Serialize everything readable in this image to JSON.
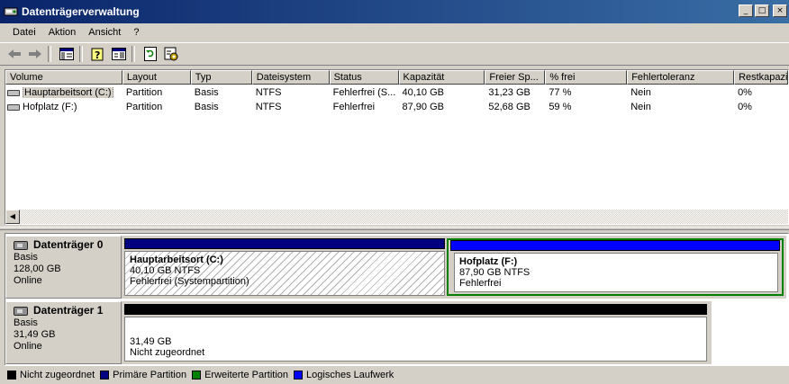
{
  "window": {
    "title": "Datenträgerverwaltung",
    "controls": {
      "minimize": "_",
      "maximize": "□",
      "close": "×"
    }
  },
  "menu": [
    "Datei",
    "Aktion",
    "Ansicht",
    "?"
  ],
  "toolbar": [
    "back-icon",
    "forward-icon",
    "show-hide-tree-icon",
    "help-icon",
    "properties-icon",
    "refresh-icon",
    "settings-icon"
  ],
  "list": {
    "columns": [
      "Volume",
      "Layout",
      "Typ",
      "Dateisystem",
      "Status",
      "Kapazität",
      "Freier Sp...",
      "% frei",
      "Fehlertoleranz",
      "Restkapazität"
    ],
    "rows": [
      {
        "volume": "Hauptarbeitsort (C:)",
        "layout": "Partition",
        "typ": "Basis",
        "fs": "NTFS",
        "status": "Fehlerfrei (S...",
        "kap": "40,10 GB",
        "frei": "31,23 GB",
        "pfrei": "77 %",
        "fehler": "Nein",
        "rest": "0%"
      },
      {
        "volume": "Hofplatz (F:)",
        "layout": "Partition",
        "typ": "Basis",
        "fs": "NTFS",
        "status": "Fehlerfrei",
        "kap": "87,90 GB",
        "frei": "52,68 GB",
        "pfrei": "59 %",
        "fehler": "Nein",
        "rest": "0%"
      }
    ]
  },
  "disks": [
    {
      "name": "Datenträger 0",
      "type": "Basis",
      "size": "128,00 GB",
      "state": "Online",
      "partitions": [
        {
          "name": "Hauptarbeitsort  (C:)",
          "line2": "40,10 GB NTFS",
          "line3": "Fehlerfrei (Systempartition)",
          "kind": "Primäre Partition"
        },
        {
          "name": "Hofplatz  (F:)",
          "line2": "87,90 GB NTFS",
          "line3": "Fehlerfrei",
          "kind": "Logisches Laufwerk"
        }
      ]
    },
    {
      "name": "Datenträger 1",
      "type": "Basis",
      "size": "31,49 GB",
      "state": "Online",
      "partitions": [
        {
          "name": "",
          "line2": "31,49 GB",
          "line3": "Nicht zugeordnet",
          "kind": "Nicht zugeordnet"
        }
      ]
    }
  ],
  "legend": [
    {
      "label": "Nicht zugeordnet",
      "color": "#000000"
    },
    {
      "label": "Primäre Partition",
      "color": "#000080"
    },
    {
      "label": "Erweiterte Partition",
      "color": "#008000"
    },
    {
      "label": "Logisches Laufwerk",
      "color": "#0000ff"
    }
  ],
  "colors": {
    "titlebar": "#0a246a",
    "selection": "#d4d0c8",
    "primary": "#000080",
    "extended": "#008000",
    "logical": "#0000ff",
    "unallocated": "#000000"
  }
}
